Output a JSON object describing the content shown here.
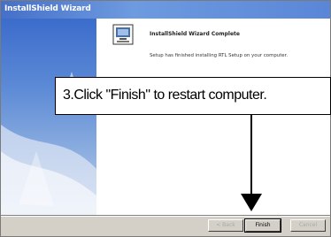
{
  "window": {
    "title": "InstallShield Wizard"
  },
  "dialog": {
    "heading": "InstallShield Wizard Complete",
    "description": "Setup has finished installing RTL Setup on your computer."
  },
  "buttons": {
    "back": "< Back",
    "finish": "Finish",
    "cancel": "Cancel"
  },
  "callout": {
    "text": "3.Click \"Finish\" to restart computer."
  },
  "icons": {
    "wizard": "computer-setup-icon",
    "arrow": "arrow-down-icon"
  },
  "colors": {
    "titlebar": "#4670c8",
    "panel": "#3c6ccc",
    "face": "#d4d0c8"
  }
}
